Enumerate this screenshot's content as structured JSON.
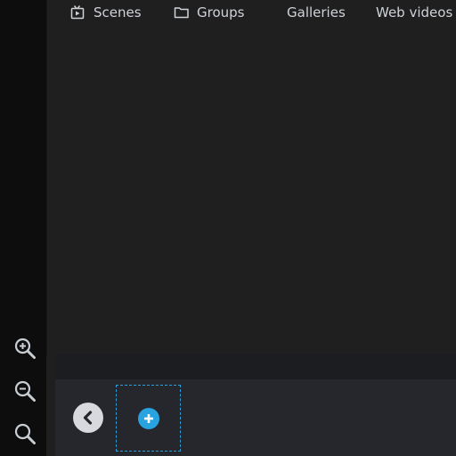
{
  "zoom_tools": [
    {
      "icon": "zoom-in-icon"
    },
    {
      "icon": "zoom-out-icon"
    },
    {
      "icon": "zoom-fit-icon"
    }
  ],
  "tabs": [
    {
      "label": "Scenes",
      "icon": "scenes-icon"
    },
    {
      "label": "Groups",
      "icon": "folder-icon"
    },
    {
      "label": "Galleries"
    },
    {
      "label": "Web videos"
    }
  ],
  "panel": {
    "back_icon": "chevron-left-icon",
    "add_icon": "plus-icon"
  },
  "colors": {
    "accent": "#2a9fd8",
    "rail": "#0d0d0d",
    "viewport": "#1f1f1f",
    "panel": "#25272d"
  }
}
